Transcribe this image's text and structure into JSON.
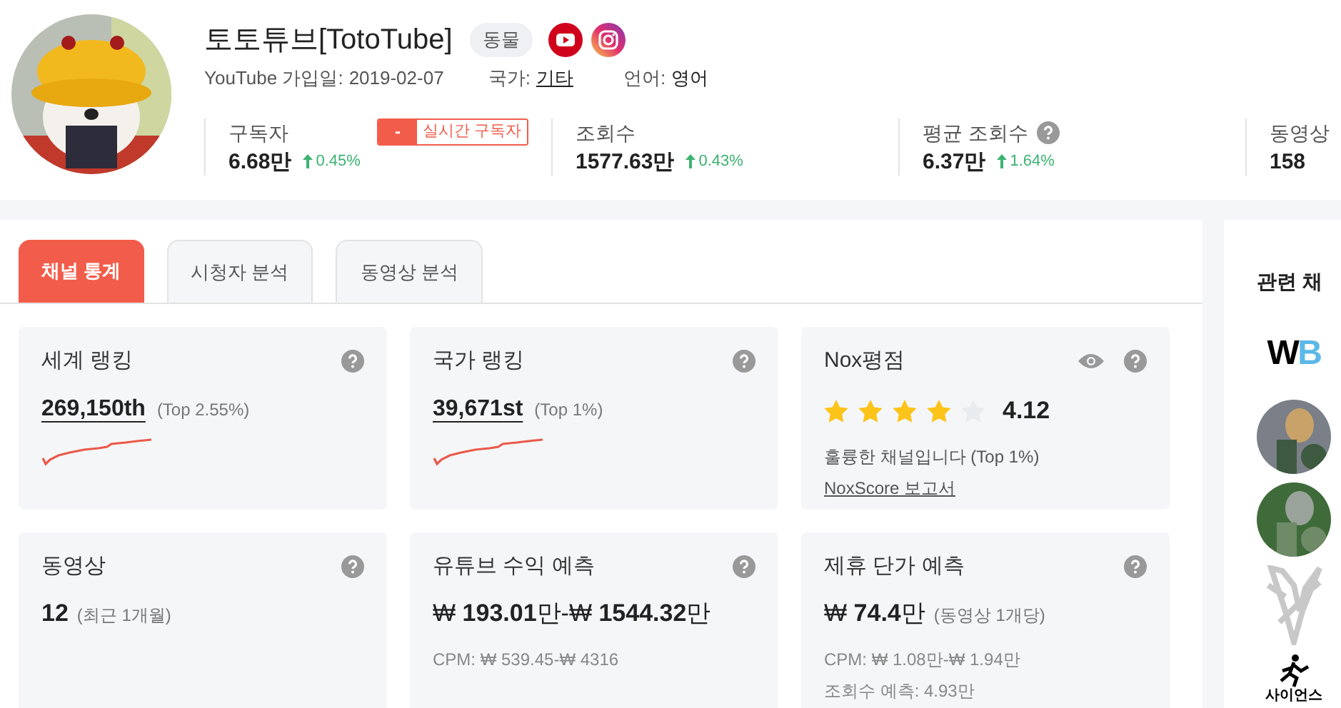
{
  "channel": {
    "name": "토토튜브[TotoTube]",
    "category": "동물",
    "joined_label": "YouTube 가입일:",
    "joined": "2019-02-07",
    "country_label": "국가:",
    "country": "기타",
    "language_label": "언어:",
    "language": "영어"
  },
  "stats": [
    {
      "label": "구독자",
      "value": "6.68만",
      "change": "0.45%",
      "help": false,
      "badge": {
        "mark": "-",
        "label": "실시간 구독자"
      }
    },
    {
      "label": "조회수",
      "value": "1577.63만",
      "change": "0.43%",
      "help": false
    },
    {
      "label": "평균 조회수",
      "value": "6.37만",
      "change": "1.64%",
      "help": true
    },
    {
      "label": "동영상",
      "value": "158",
      "help": false
    }
  ],
  "tabs": [
    {
      "label": "채널 통계",
      "selected": true
    },
    {
      "label": "시청자 분석",
      "selected": false
    },
    {
      "label": "동영상 분석",
      "selected": false
    }
  ],
  "cards": [
    {
      "kind": "rank",
      "title": "세계 랭킹",
      "value": "269,150th",
      "note": "(Top 2.55%)"
    },
    {
      "kind": "rank",
      "title": "국가 랭킹",
      "value": "39,671st",
      "note": "(Top 1%)"
    },
    {
      "kind": "rating",
      "title": "Nox평점",
      "stars": 4,
      "score": "4.12",
      "note": "훌륭한 채널입니다 (Top 1%)",
      "link": "NoxScore 보고서"
    },
    {
      "kind": "count",
      "title": "동영상",
      "value": "12",
      "note": "(최근 1개월)"
    },
    {
      "kind": "income",
      "title": "유튜브 수익 예측",
      "parts": [
        "₩ ",
        "193.01",
        "만-₩ ",
        "1544.32",
        "만"
      ],
      "lines": [
        "CPM: ₩ 539.45-₩ 4316"
      ]
    },
    {
      "kind": "price",
      "title": "제휴 단가 예측",
      "parts": [
        "₩ ",
        "74.4",
        "만"
      ],
      "note": "(동영상 1개당)",
      "lines": [
        "CPM: ₩ 1.08만-₩ 1.94만",
        "조회수 예측: 4.93만"
      ]
    }
  ],
  "related": {
    "title": "관련 채",
    "items": [
      {
        "kind": "wordmark",
        "label": "WB"
      },
      {
        "kind": "picture"
      },
      {
        "kind": "picture"
      },
      {
        "kind": "drawing"
      },
      {
        "kind": "runner",
        "label": "사이언스"
      }
    ]
  }
}
